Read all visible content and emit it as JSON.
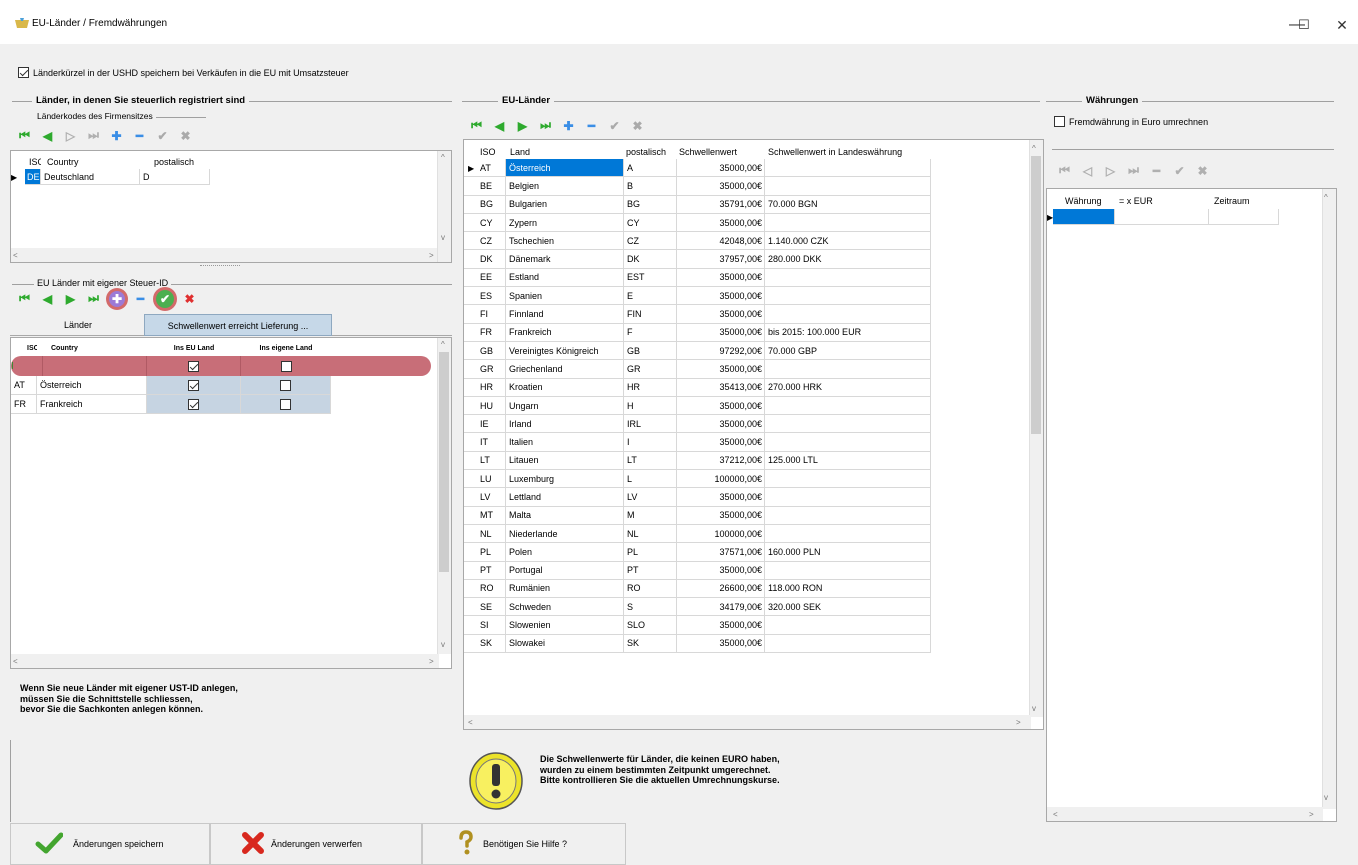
{
  "window": {
    "title": "EU-Länder / Fremdwährungen",
    "minimize": "—",
    "maximize": "☐",
    "close": "✕"
  },
  "top_checkbox": {
    "label": "Länderkürzel in der USHD speichern bei Verkäufen in die EU mit Umsatzsteuer",
    "checked": true
  },
  "left": {
    "group_title": "Länder, in denen Sie steuerlich registriert sind",
    "subgroup_title": "Länderkodes des Firmensitzes",
    "headers": [
      "ISO",
      "Country",
      "postalisch"
    ],
    "rows": [
      {
        "iso": "DE",
        "country": "Deutschland",
        "postal": "D"
      }
    ],
    "eu_title": "EU Länder mit eigener Steuer-ID",
    "tabs": [
      "Länder",
      "Schwellenwert erreicht Lieferung ..."
    ],
    "eu_headers": [
      "ISO",
      "Country",
      "Ins EU Land",
      "Ins eigene Land"
    ],
    "eu_rows": [
      {
        "iso": "",
        "country": "",
        "eu": true,
        "own": false
      },
      {
        "iso": "AT",
        "country": "Österreich",
        "eu": true,
        "own": false
      },
      {
        "iso": "FR",
        "country": "Frankreich",
        "eu": true,
        "own": false
      }
    ],
    "note": [
      "Wenn Sie neue  Länder mit eigener UST-ID anlegen,",
      "müssen Sie die Schnittstelle schliessen,",
      "bevor Sie die Sachkonten anlegen können."
    ]
  },
  "middle": {
    "group_title": "EU-Länder",
    "headers": [
      "ISO",
      "Land",
      "postalisch",
      "Schwellenwert",
      "Schwellenwert in Landeswährung"
    ],
    "rows": [
      [
        "AT",
        "Österreich",
        "A",
        "35000,00€",
        ""
      ],
      [
        "BE",
        "Belgien",
        "B",
        "35000,00€",
        ""
      ],
      [
        "BG",
        "Bulgarien",
        "BG",
        "35791,00€",
        "70.000 BGN"
      ],
      [
        "CY",
        "Zypern",
        "CY",
        "35000,00€",
        ""
      ],
      [
        "CZ",
        "Tschechien",
        "CZ",
        "42048,00€",
        "1.140.000 CZK"
      ],
      [
        "DK",
        "Dänemark",
        "DK",
        "37957,00€",
        "280.000 DKK"
      ],
      [
        "EE",
        "Estland",
        "EST",
        "35000,00€",
        ""
      ],
      [
        "ES",
        "Spanien",
        "E",
        "35000,00€",
        ""
      ],
      [
        "FI",
        "Finnland",
        "FIN",
        "35000,00€",
        ""
      ],
      [
        "FR",
        "Frankreich",
        "F",
        "35000,00€",
        "bis 2015: 100.000 EUR"
      ],
      [
        "GB",
        "Vereinigtes Königreich",
        "GB",
        "97292,00€",
        "70.000 GBP"
      ],
      [
        "GR",
        "Griechenland",
        "GR",
        "35000,00€",
        ""
      ],
      [
        "HR",
        "Kroatien",
        "HR",
        "35413,00€",
        "270.000 HRK"
      ],
      [
        "HU",
        "Ungarn",
        "H",
        "35000,00€",
        ""
      ],
      [
        "IE",
        "Irland",
        "IRL",
        "35000,00€",
        ""
      ],
      [
        "IT",
        "Italien",
        "I",
        "35000,00€",
        ""
      ],
      [
        "LT",
        "Litauen",
        "LT",
        "37212,00€",
        "125.000 LTL"
      ],
      [
        "LU",
        "Luxemburg",
        "L",
        "100000,00€",
        ""
      ],
      [
        "LV",
        "Lettland",
        "LV",
        "35000,00€",
        ""
      ],
      [
        "MT",
        "Malta",
        "M",
        "35000,00€",
        ""
      ],
      [
        "NL",
        "Niederlande",
        "NL",
        "100000,00€",
        ""
      ],
      [
        "PL",
        "Polen",
        "PL",
        "37571,00€",
        "160.000 PLN"
      ],
      [
        "PT",
        "Portugal",
        "PT",
        "35000,00€",
        ""
      ],
      [
        "RO",
        "Rumänien",
        "RO",
        "26600,00€",
        "118.000 RON"
      ],
      [
        "SE",
        "Schweden",
        "S",
        "34179,00€",
        "320.000 SEK"
      ],
      [
        "SI",
        "Slowenien",
        "SLO",
        "35000,00€",
        ""
      ],
      [
        "SK",
        "Slowakei",
        "SK",
        "35000,00€",
        ""
      ]
    ],
    "info": [
      "Die Schwellenwerte für Länder, die keinen EURO haben,",
      "wurden zu einem bestimmten Zeitpunkt umgerechnet.",
      "Bitte kontrollieren Sie die aktuellen Umrechnungskurse."
    ]
  },
  "right": {
    "group_title": "Währungen",
    "checkbox_label": "Fremdwährung in Euro umrechnen",
    "headers": [
      "Währung",
      "= x EUR",
      "Zeitraum"
    ]
  },
  "bottom": {
    "save": "Änderungen speichern",
    "discard": "Änderungen verwerfen",
    "help": "Benötigen Sie Hilfe ?"
  }
}
